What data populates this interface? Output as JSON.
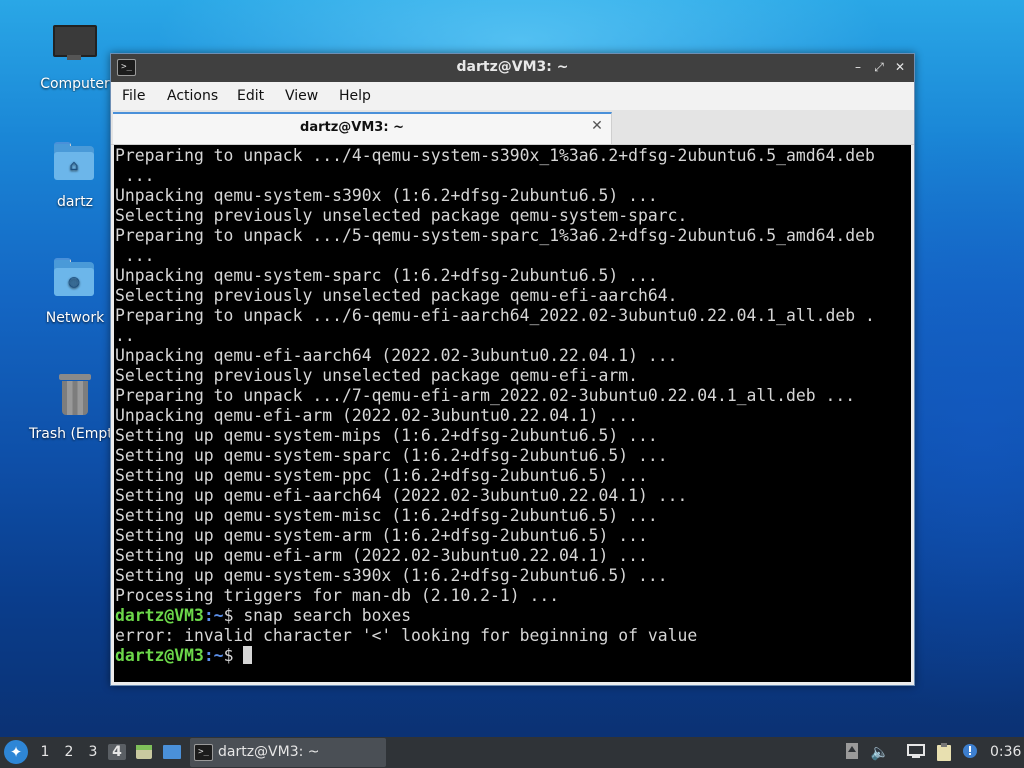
{
  "desktop": {
    "icons": [
      {
        "label": "Computer",
        "icon": "computer-icon"
      },
      {
        "label": "dartz",
        "icon": "home-folder-icon"
      },
      {
        "label": "Network",
        "icon": "network-folder-icon"
      },
      {
        "label": "Trash (Empty)",
        "icon": "trash-icon"
      }
    ]
  },
  "window": {
    "title": "dartz@VM3: ~",
    "controls": {
      "minimize": "–",
      "maximize": "⤢",
      "close": "✕"
    },
    "menu": [
      "File",
      "Actions",
      "Edit",
      "View",
      "Help"
    ],
    "tab": {
      "label": "dartz@VM3: ~",
      "close": "✕"
    }
  },
  "terminal": {
    "output_lines": [
      "Preparing to unpack .../4-qemu-system-s390x_1%3a6.2+dfsg-2ubuntu6.5_amd64.deb",
      " ...",
      "Unpacking qemu-system-s390x (1:6.2+dfsg-2ubuntu6.5) ...",
      "Selecting previously unselected package qemu-system-sparc.",
      "Preparing to unpack .../5-qemu-system-sparc_1%3a6.2+dfsg-2ubuntu6.5_amd64.deb",
      " ...",
      "Unpacking qemu-system-sparc (1:6.2+dfsg-2ubuntu6.5) ...",
      "Selecting previously unselected package qemu-efi-aarch64.",
      "Preparing to unpack .../6-qemu-efi-aarch64_2022.02-3ubuntu0.22.04.1_all.deb .",
      "..",
      "Unpacking qemu-efi-aarch64 (2022.02-3ubuntu0.22.04.1) ...",
      "Selecting previously unselected package qemu-efi-arm.",
      "Preparing to unpack .../7-qemu-efi-arm_2022.02-3ubuntu0.22.04.1_all.deb ...",
      "Unpacking qemu-efi-arm (2022.02-3ubuntu0.22.04.1) ...",
      "Setting up qemu-system-mips (1:6.2+dfsg-2ubuntu6.5) ...",
      "Setting up qemu-system-sparc (1:6.2+dfsg-2ubuntu6.5) ...",
      "Setting up qemu-system-ppc (1:6.2+dfsg-2ubuntu6.5) ...",
      "Setting up qemu-efi-aarch64 (2022.02-3ubuntu0.22.04.1) ...",
      "Setting up qemu-system-misc (1:6.2+dfsg-2ubuntu6.5) ...",
      "Setting up qemu-system-arm (1:6.2+dfsg-2ubuntu6.5) ...",
      "Setting up qemu-efi-arm (2022.02-3ubuntu0.22.04.1) ...",
      "Setting up qemu-system-s390x (1:6.2+dfsg-2ubuntu6.5) ...",
      "Processing triggers for man-db (2.10.2-1) ..."
    ],
    "prompt_user": "dartz@VM3",
    "prompt_path": ":~",
    "prompt_symbol": "$ ",
    "command": "snap search boxes",
    "error_line": "error: invalid character '<' looking for beginning of value",
    "colors": {
      "user": "#6cd84a",
      "path": "#5b8fe8",
      "text": "#d6d6d6",
      "background": "#000000"
    }
  },
  "taskbar": {
    "workspaces": [
      "1",
      "2",
      "3",
      "4"
    ],
    "active_workspace": "4",
    "task_label": "dartz@VM3: ~",
    "clock": "0:36",
    "tray_icons": [
      "upload-icon",
      "volume-icon",
      "network-icon",
      "clipboard-icon",
      "update-notifier-icon"
    ]
  }
}
